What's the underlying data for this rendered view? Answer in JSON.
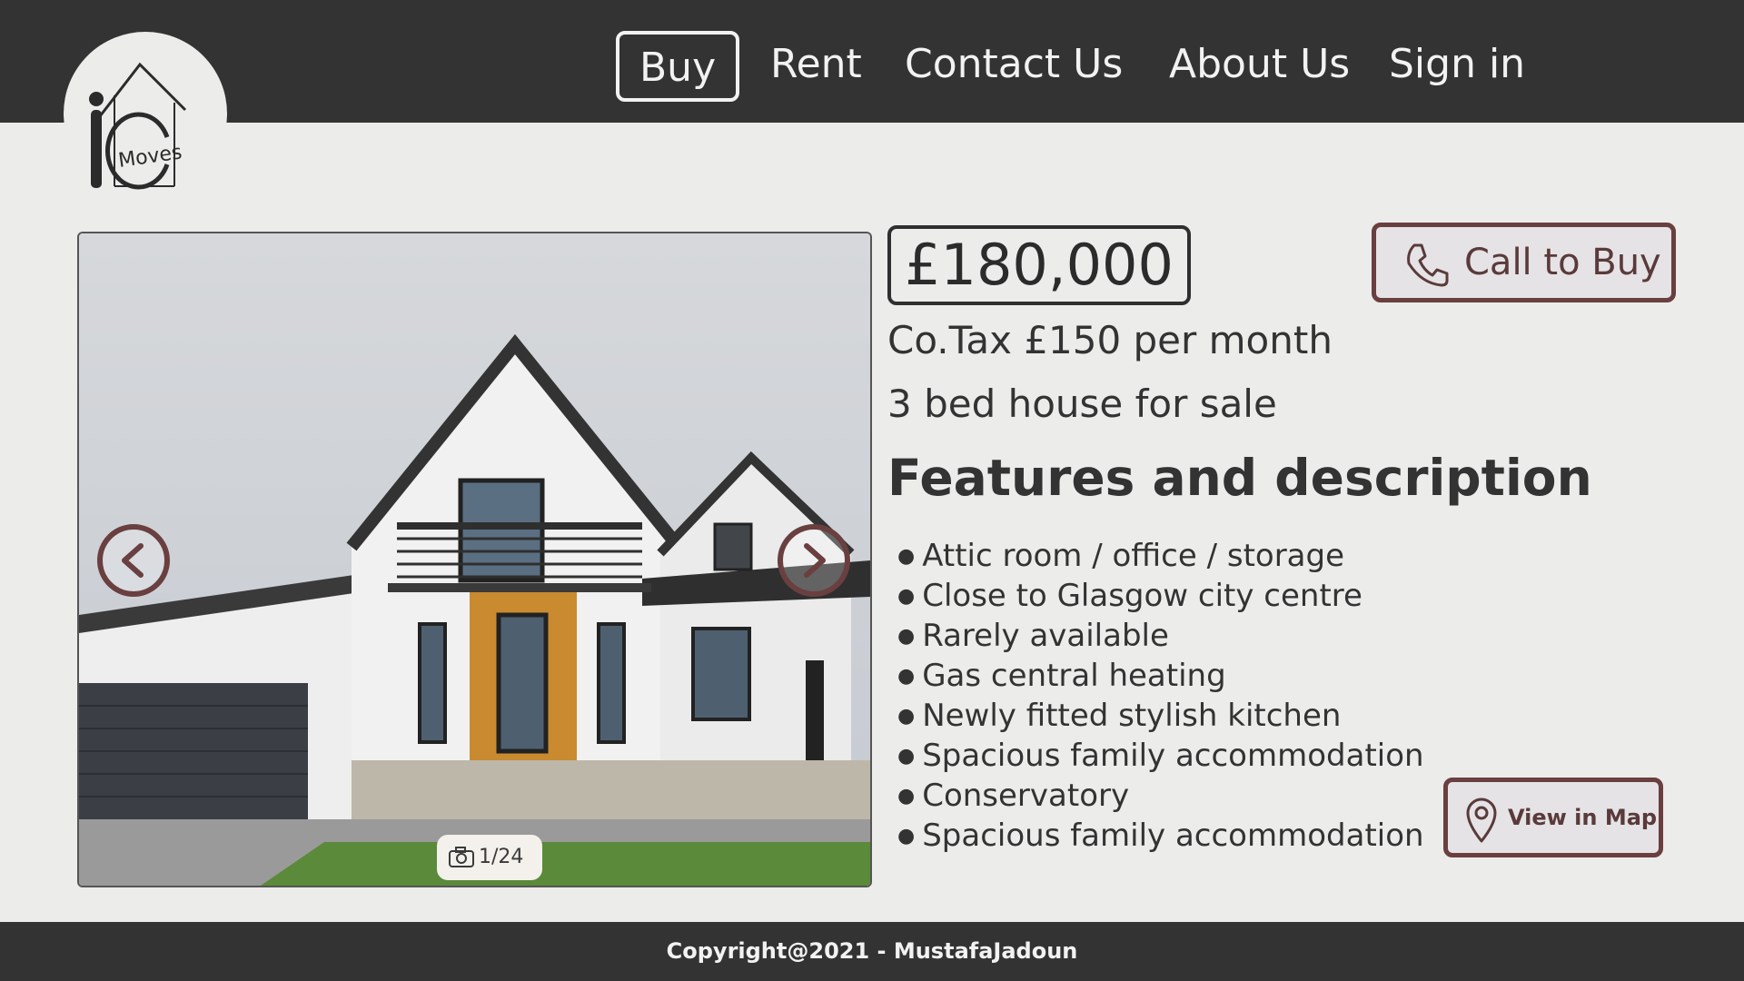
{
  "brand": {
    "logo_text": "Moves",
    "logo_letters": "iC"
  },
  "nav": {
    "items": [
      {
        "label": "Buy",
        "active": true
      },
      {
        "label": "Rent",
        "active": false
      },
      {
        "label": "Contact Us",
        "active": false
      },
      {
        "label": "About Us",
        "active": false
      },
      {
        "label": "Sign in",
        "active": false
      }
    ]
  },
  "listing": {
    "price": "£180,000",
    "council_tax": "Co.Tax £150 per month",
    "title": "3 bed house for sale",
    "features_heading": "Features and description",
    "features": [
      "Attic room / office / storage",
      "Close to Glasgow city centre",
      "Rarely available",
      "Gas central heating",
      "Newly fitted stylish kitchen",
      "Spacious family accommodation",
      "Conservatory",
      "Spacious family accommodation"
    ]
  },
  "gallery": {
    "counter": "1/24"
  },
  "actions": {
    "call_label": "Call to Buy",
    "map_label": "View in Map"
  },
  "footer": {
    "copyright": "Copyright@2021 - MustafaJadoun"
  },
  "colors": {
    "header_bg": "#333333",
    "page_bg": "#ececea",
    "accent": "#6a3f3f",
    "button_bg": "#e5e3e6"
  },
  "icons": {
    "logo": "house-logo-icon",
    "prev": "chevron-left-icon",
    "next": "chevron-right-icon",
    "camera": "camera-icon",
    "phone": "phone-icon",
    "map": "map-pin-icon"
  }
}
